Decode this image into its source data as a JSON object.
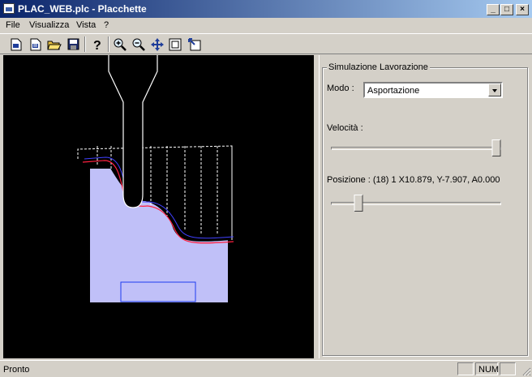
{
  "window": {
    "title": "PLAC_WEB.plc - Placchette",
    "controls": {
      "minimize": "_",
      "maximize": "□",
      "close": "×"
    }
  },
  "menu": [
    "File",
    "Visualizza",
    "Vista",
    "?"
  ],
  "toolbar": {
    "buttons": [
      "new-document-icon",
      "new-view-icon",
      "open-folder-icon",
      "save-disk-icon",
      "help-icon",
      "zoom-in-icon",
      "zoom-out-icon",
      "pan-icon",
      "zoom-extents-icon",
      "zoom-window-icon"
    ]
  },
  "panel": {
    "group_title": "Simulazione Lavorazione",
    "mode_label": "Modo :",
    "mode_value": "Asportazione",
    "speed_label": "Velocità :",
    "speed_level": 0.97,
    "position_label": "Posizione : (18) 1 X10.879, Y-7.907, A0.000",
    "position_level": 0.16
  },
  "status": {
    "text": "Pronto",
    "num": "NUM"
  },
  "colors": {
    "titlebar_start": "#0a246a",
    "titlebar_end": "#a6caf0",
    "canvas_bg": "#000000",
    "workpiece": "#c0c0f8",
    "cut_path": "#ff0000",
    "tool": "#ffffff",
    "window_bg": "#d4d0c8"
  }
}
